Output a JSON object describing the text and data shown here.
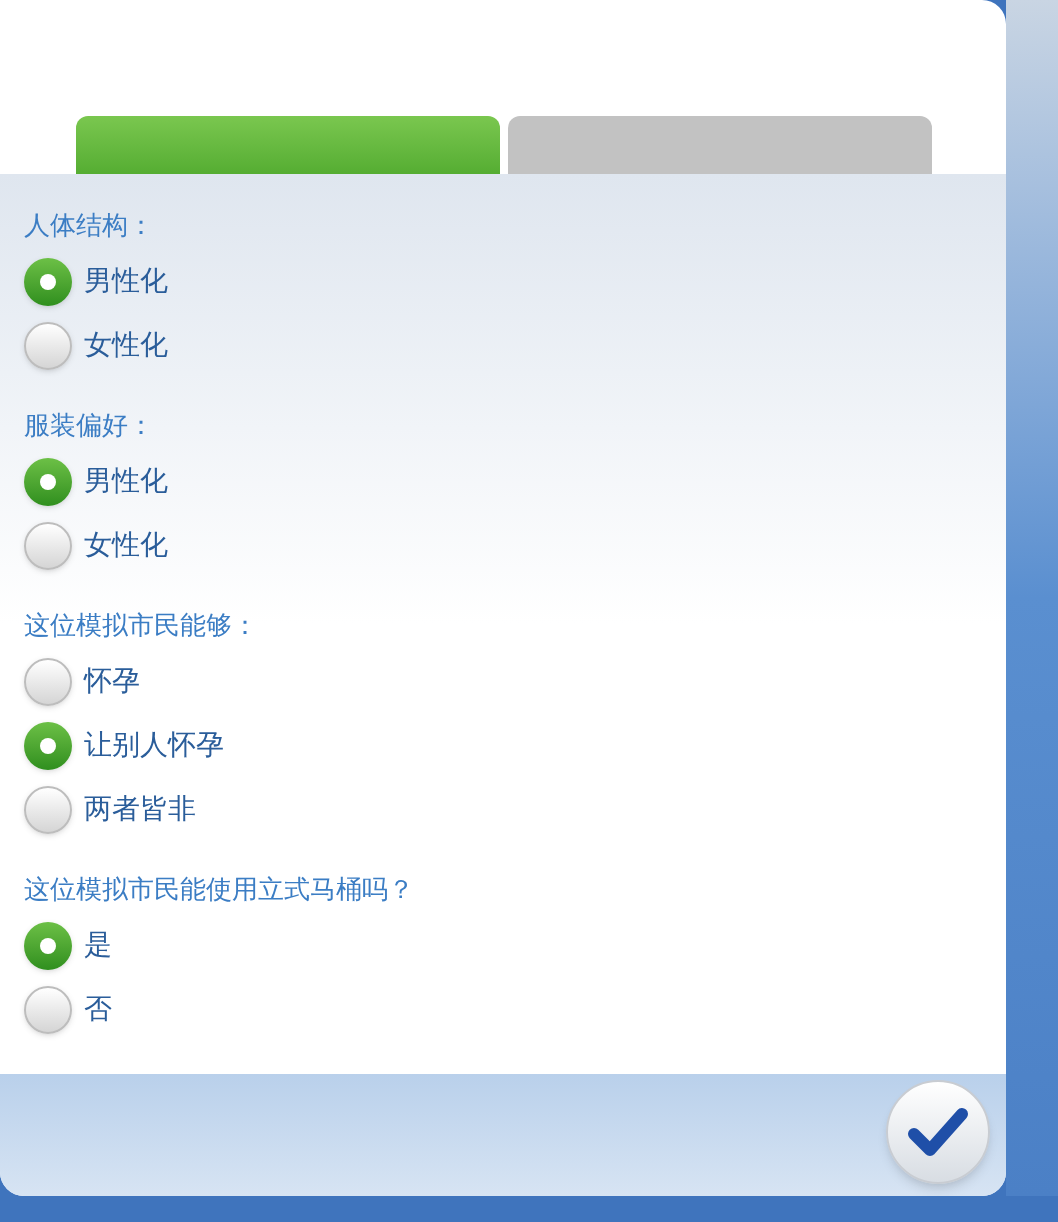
{
  "tabs": [
    {
      "selected": true
    },
    {
      "selected": false
    }
  ],
  "groups": [
    {
      "label": "人体结构：",
      "options": [
        {
          "label": "男性化",
          "selected": true
        },
        {
          "label": "女性化",
          "selected": false
        }
      ]
    },
    {
      "label": "服装偏好：",
      "options": [
        {
          "label": "男性化",
          "selected": true
        },
        {
          "label": "女性化",
          "selected": false
        }
      ]
    },
    {
      "label": "这位模拟市民能够：",
      "options": [
        {
          "label": "怀孕",
          "selected": false
        },
        {
          "label": "让别人怀孕",
          "selected": true
        },
        {
          "label": "两者皆非",
          "selected": false
        }
      ]
    },
    {
      "label": "这位模拟市民能使用立式马桶吗？",
      "options": [
        {
          "label": "是",
          "selected": true
        },
        {
          "label": "否",
          "selected": false
        }
      ]
    }
  ]
}
